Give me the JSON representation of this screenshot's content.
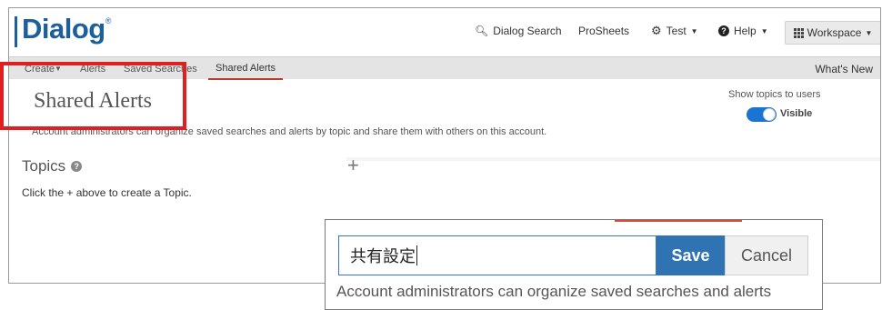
{
  "header": {
    "logo_text": "Dialog",
    "logo_mark": "®",
    "nav": {
      "dialog_search": "Dialog Search",
      "prosheets": "ProSheets",
      "test": "Test",
      "help": "Help",
      "workspace": "Workspace"
    }
  },
  "subnav": {
    "items": [
      "Create",
      "Alerts",
      "Saved Searches",
      "Shared Alerts"
    ],
    "active": "Shared Alerts",
    "whats_new": "What's New"
  },
  "main": {
    "title": "Shared Alerts",
    "description": "Account administrators can organize saved searches and alerts by topic and share them with others on this account.",
    "show_topics_label": "Show topics to users",
    "toggle_state": "Visible",
    "topics_title": "Topics",
    "add_topic_symbol": "+",
    "hint": "Click the + above to create a Topic."
  },
  "inset": {
    "input_value": "共有設定",
    "save_label": "Save",
    "cancel_label": "Cancel",
    "description": "Account administrators can organize saved searches and alerts"
  },
  "colors": {
    "brand": "#1c5f99",
    "highlight": "#e02020",
    "save_button": "#2f73b3",
    "toggle_on": "#1a74d1"
  }
}
